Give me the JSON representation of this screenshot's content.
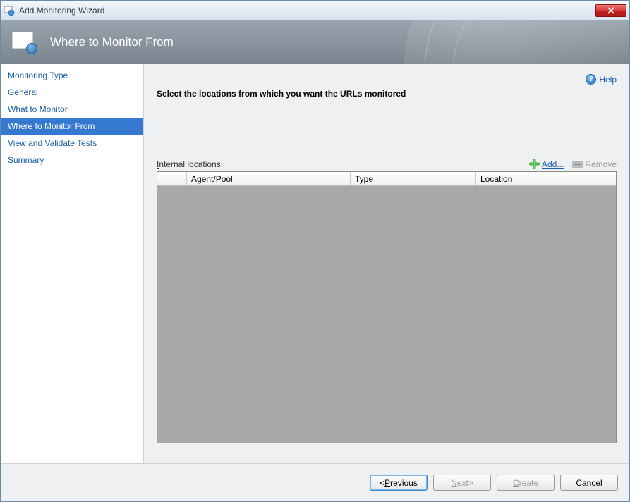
{
  "titlebar": {
    "title": "Add Monitoring Wizard"
  },
  "banner": {
    "title": "Where to Monitor From"
  },
  "sidebar": {
    "items": [
      {
        "label": "Monitoring Type"
      },
      {
        "label": "General"
      },
      {
        "label": "What to Monitor"
      },
      {
        "label": "Where to Monitor From"
      },
      {
        "label": "View and Validate Tests"
      },
      {
        "label": "Summary"
      }
    ]
  },
  "main": {
    "help_label": "Help",
    "instruction": "Select the locations from which you want the URLs monitored",
    "list_label_prefix": "I",
    "list_label_rest": "nternal locations:",
    "add_prefix": "A",
    "add_rest": "dd...",
    "remove_label": "Remove",
    "columns": {
      "agent": "Agent/Pool",
      "type": "Type",
      "location": "Location"
    }
  },
  "footer": {
    "previous_prefix": "P",
    "previous_rest": "revious",
    "next_prefix": "N",
    "next_rest": "ext",
    "create_prefix": "C",
    "create_rest": "reate",
    "cancel_label": "Cancel"
  }
}
